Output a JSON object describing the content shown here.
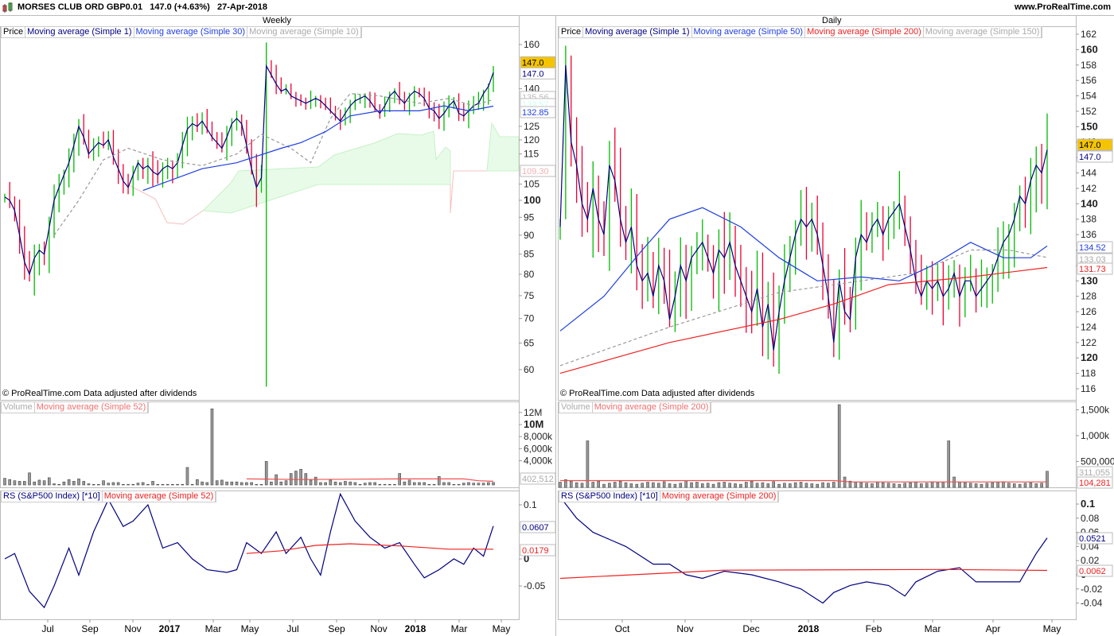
{
  "header": {
    "title": "MORSES CLUB ORD GBP0.01",
    "price": "147.0",
    "change": "(+4.63%)",
    "date": "27-Apr-2018",
    "site": "www.ProRealTime.com"
  },
  "left": {
    "period": "Weekly",
    "price_legend": [
      "Price",
      "Moving average (Simple 1)",
      "Moving average (Simple 30)",
      "Moving average (Simple 10)"
    ],
    "vol_legend": [
      "Volume",
      "Moving average (Simple 52)"
    ],
    "rs_legend": [
      "RS (S&P500 Index) [*10]",
      "Moving average (Simple 52)"
    ],
    "copyright": "© ProRealTime.com  Data adjusted after dividends",
    "price_ticks": [
      "160",
      "140",
      "125",
      "120",
      "115",
      "105",
      "100",
      "95",
      "90",
      "85",
      "80",
      "75",
      "70",
      "65",
      "60"
    ],
    "price_tags": {
      "last": "147.0",
      "ma1": "147.0",
      "ma10": "135.56",
      "cloud": "133.57",
      "ma30": "132.85",
      "cloud_low": "109.30"
    },
    "vol_ticks": [
      "12M",
      "10M",
      "8,000k",
      "6,000k",
      "4,000k"
    ],
    "vol_tag": "402,512",
    "rs_ticks": [
      "0.1",
      "0",
      "-0.05"
    ],
    "rs_tags": {
      "rs": "0.0607",
      "ma": "0.0179"
    },
    "x_labels": [
      "Jul",
      "Sep",
      "Nov",
      "2017",
      "Mar",
      "May",
      "Jul",
      "Sep",
      "Nov",
      "2018",
      "Mar",
      "May"
    ]
  },
  "right": {
    "period": "Daily",
    "price_legend": [
      "Price",
      "Moving average (Simple 1)",
      "Moving average (Simple 50)",
      "Moving average (Simple 200)",
      "Moving average (Simple 150)"
    ],
    "vol_legend": [
      "Volume",
      "Moving average (Simple 200)"
    ],
    "rs_legend": [
      "RS (S&P500 Index) [*10]",
      "Moving average (Simple 200)"
    ],
    "copyright": "© ProRealTime.com  Data adjusted after dividends",
    "price_ticks": [
      "162",
      "160",
      "158",
      "156",
      "154",
      "152",
      "150",
      "148",
      "146",
      "144",
      "142",
      "140",
      "138",
      "136",
      "134",
      "132",
      "130",
      "128",
      "126",
      "124",
      "122",
      "120",
      "118",
      "116"
    ],
    "price_tags": {
      "last": "147.0",
      "ma1": "147.0",
      "ma50": "134.52",
      "ma150": "133.03",
      "ma200": "131.73"
    },
    "vol_ticks": [
      "1,500k",
      "1,000k",
      "500,000"
    ],
    "vol_tags": {
      "vol": "311,055",
      "ma": "104,281"
    },
    "rs_ticks": [
      "0.1",
      "0.08",
      "0.06",
      "0.04",
      "0.02",
      "0",
      "-0.02",
      "-0.04"
    ],
    "rs_tags": {
      "rs": "0.0521",
      "ma": "0.0062"
    },
    "x_labels": [
      "Oct",
      "Nov",
      "Dec",
      "2018",
      "Feb",
      "Mar",
      "Apr",
      "May"
    ]
  },
  "colors": {
    "up": "#00bb00",
    "down": "#ee0033",
    "ma1": "#000080",
    "ma_blue": "#1f3fe0",
    "ma_red": "#ee2222",
    "ma_grey": "#999999",
    "highlight": "#f5c400"
  },
  "chart_data": [
    {
      "type": "bar",
      "title": "Weekly",
      "scale": "log",
      "ylim": [
        56,
        165
      ],
      "close": [
        101,
        100,
        97,
        90,
        83,
        80,
        84,
        86,
        85,
        92,
        100,
        104,
        108,
        112,
        118,
        125,
        121,
        115,
        117,
        119,
        118,
        120,
        114,
        110,
        106,
        104,
        108,
        112,
        110,
        111,
        109,
        108,
        110,
        111,
        110,
        112,
        118,
        124,
        126,
        125,
        127,
        124,
        121,
        119,
        117,
        121,
        126,
        128,
        126,
        118,
        110,
        104,
        107,
        150,
        146,
        142,
        139,
        140,
        137,
        136,
        135,
        134,
        135,
        136,
        135,
        133,
        131,
        129,
        127,
        130,
        133,
        135,
        136,
        137,
        135,
        132,
        130,
        133,
        137,
        139,
        136,
        134,
        137,
        139,
        138,
        136,
        132,
        131,
        128,
        130,
        133,
        135,
        130,
        129,
        131,
        133,
        134,
        138,
        141,
        147
      ],
      "spikes": [
        {
          "index": 53,
          "low": 57,
          "high": 161
        },
        {
          "index": 51,
          "low": 98,
          "high": 115
        }
      ],
      "ma30": [
        [
          28,
          103
        ],
        [
          40,
          110
        ],
        [
          47,
          112
        ],
        [
          56,
          117
        ],
        [
          60,
          119
        ],
        [
          65,
          123
        ],
        [
          70,
          129
        ],
        [
          76,
          131
        ],
        [
          84,
          131
        ],
        [
          89,
          133
        ],
        [
          94,
          131
        ],
        [
          99,
          132.85
        ]
      ],
      "ma10": [
        [
          10,
          90
        ],
        [
          15,
          100
        ],
        [
          20,
          113
        ],
        [
          25,
          117
        ],
        [
          32,
          113
        ],
        [
          40,
          111
        ],
        [
          47,
          115
        ],
        [
          52,
          122
        ],
        [
          58,
          117
        ],
        [
          62,
          112
        ],
        [
          66,
          128
        ],
        [
          70,
          138
        ],
        [
          76,
          137
        ],
        [
          84,
          134
        ],
        [
          90,
          136
        ],
        [
          95,
          133
        ],
        [
          99,
          135.56
        ]
      ],
      "volume_k": [
        1100,
        900,
        700,
        600,
        600,
        2000,
        500,
        800,
        700,
        1200,
        200,
        100,
        500,
        900,
        600,
        1000,
        600,
        200,
        100,
        100,
        700,
        300,
        400,
        400,
        100,
        100,
        100,
        300,
        400,
        100,
        600,
        100,
        100,
        100,
        100,
        100,
        100,
        2900,
        100,
        900,
        500,
        400,
        12600,
        700,
        800,
        500,
        500,
        500,
        400,
        400,
        400,
        100,
        100,
        3900,
        500,
        1700,
        500,
        700,
        1900,
        2300,
        2600,
        1900,
        800,
        1300,
        400,
        400,
        800,
        500,
        400,
        600,
        500,
        400,
        100,
        300,
        400,
        400,
        100,
        100,
        100,
        100,
        1900,
        500,
        800,
        400,
        400,
        400,
        100,
        100,
        1400,
        400,
        400,
        100,
        100,
        300,
        400,
        300,
        300,
        300,
        400,
        402
      ],
      "vol_ma_k": [
        [
          49,
          1000
        ],
        [
          60,
          900
        ],
        [
          70,
          950
        ],
        [
          80,
          1000
        ],
        [
          93,
          1000
        ],
        [
          96,
          700
        ],
        [
          99,
          600
        ]
      ],
      "rs": [
        [
          0,
          0.0
        ],
        [
          2,
          0.01
        ],
        [
          5,
          -0.06
        ],
        [
          8,
          -0.09
        ],
        [
          10,
          -0.05
        ],
        [
          13,
          0.02
        ],
        [
          15,
          -0.03
        ],
        [
          18,
          0.05
        ],
        [
          21,
          0.11
        ],
        [
          24,
          0.06
        ],
        [
          26,
          0.07
        ],
        [
          29,
          0.1
        ],
        [
          32,
          0.02
        ],
        [
          35,
          0.03
        ],
        [
          38,
          0.0
        ],
        [
          41,
          -0.02
        ],
        [
          45,
          -0.025
        ],
        [
          47,
          -0.02
        ],
        [
          49,
          0.03
        ],
        [
          52,
          0.01
        ],
        [
          55,
          0.05
        ],
        [
          57,
          0.01
        ],
        [
          60,
          0.04
        ],
        [
          62,
          0.0
        ],
        [
          64,
          -0.03
        ],
        [
          66,
          0.05
        ],
        [
          68,
          0.12
        ],
        [
          71,
          0.07
        ],
        [
          74,
          0.04
        ],
        [
          77,
          0.02
        ],
        [
          80,
          0.03
        ],
        [
          83,
          -0.01
        ],
        [
          85,
          -0.035
        ],
        [
          88,
          -0.02
        ],
        [
          91,
          0.0
        ],
        [
          93,
          -0.01
        ],
        [
          95,
          0.02
        ],
        [
          97,
          0.005
        ],
        [
          99,
          0.0607
        ]
      ],
      "rs_ma": [
        [
          49,
          0.01
        ],
        [
          56,
          0.015
        ],
        [
          63,
          0.025
        ],
        [
          70,
          0.028
        ],
        [
          80,
          0.024
        ],
        [
          90,
          0.018
        ],
        [
          99,
          0.0179
        ]
      ]
    },
    {
      "type": "bar",
      "title": "Daily",
      "scale": "linear",
      "ylim": [
        115,
        163
      ],
      "close": [
        137,
        158,
        148,
        145,
        140,
        138,
        142,
        138,
        136,
        145,
        143,
        138,
        135,
        137,
        132,
        130,
        131,
        128,
        132,
        130,
        125,
        128,
        132,
        130,
        133,
        134,
        135,
        133,
        131,
        134,
        133,
        135,
        132,
        130,
        128,
        126,
        129,
        124,
        127,
        121,
        126,
        130,
        133,
        136,
        138,
        137,
        138,
        136,
        132,
        128,
        122,
        130,
        126,
        125,
        133,
        136,
        135,
        137,
        138,
        136,
        138,
        139,
        140,
        137,
        134,
        130,
        128,
        130,
        129,
        130,
        128,
        129,
        131,
        128,
        130,
        130,
        128,
        129,
        130,
        131,
        133,
        135,
        136,
        138,
        141,
        140,
        143,
        145,
        144,
        147
      ],
      "ma50": [
        [
          0,
          123.5
        ],
        [
          8,
          128
        ],
        [
          15,
          134
        ],
        [
          20,
          138
        ],
        [
          26,
          139.5
        ],
        [
          33,
          137
        ],
        [
          40,
          133
        ],
        [
          47,
          130
        ],
        [
          55,
          130.5
        ],
        [
          62,
          130
        ],
        [
          68,
          132
        ],
        [
          75,
          135
        ],
        [
          81,
          133
        ],
        [
          86,
          133
        ],
        [
          89,
          134.52
        ]
      ],
      "ma200": [
        [
          0,
          118
        ],
        [
          20,
          122
        ],
        [
          40,
          125
        ],
        [
          50,
          127
        ],
        [
          60,
          129.5
        ],
        [
          75,
          130.5
        ],
        [
          89,
          131.73
        ]
      ],
      "ma150": [
        [
          0,
          119
        ],
        [
          20,
          124
        ],
        [
          40,
          128.5
        ],
        [
          55,
          130
        ],
        [
          65,
          131
        ],
        [
          75,
          134
        ],
        [
          82,
          134
        ],
        [
          89,
          133.03
        ]
      ],
      "volume_k": [
        100,
        150,
        120,
        90,
        80,
        900,
        100,
        120,
        60,
        80,
        100,
        120,
        90,
        70,
        60,
        80,
        100,
        90,
        80,
        110,
        70,
        60,
        80,
        130,
        90,
        100,
        70,
        80,
        60,
        90,
        100,
        80,
        70,
        60,
        100,
        120,
        80,
        90,
        70,
        110,
        60,
        80,
        70,
        90,
        100,
        80,
        70,
        60,
        90,
        80,
        100,
        1600,
        200,
        120,
        100,
        90,
        80,
        70,
        100,
        90,
        80,
        70,
        60,
        80,
        90,
        100,
        70,
        80,
        110,
        90,
        100,
        900,
        200,
        100,
        90,
        80,
        70,
        60,
        80,
        90,
        100,
        110,
        80,
        70,
        60,
        80,
        90,
        70,
        80,
        311
      ],
      "vol_ma_k": [
        [
          0,
          130
        ],
        [
          50,
          130
        ],
        [
          53,
          105
        ],
        [
          89,
          104
        ]
      ],
      "rs": [
        [
          0,
          0.11
        ],
        [
          3,
          0.08
        ],
        [
          6,
          0.06
        ],
        [
          9,
          0.05
        ],
        [
          12,
          0.04
        ],
        [
          14,
          0.03
        ],
        [
          17,
          0.015
        ],
        [
          20,
          0.015
        ],
        [
          23,
          0.0
        ],
        [
          26,
          -0.005
        ],
        [
          30,
          0.005
        ],
        [
          35,
          0.0
        ],
        [
          40,
          -0.01
        ],
        [
          44,
          -0.02
        ],
        [
          46,
          -0.03
        ],
        [
          48,
          -0.04
        ],
        [
          50,
          -0.025
        ],
        [
          53,
          -0.015
        ],
        [
          56,
          -0.01
        ],
        [
          60,
          -0.015
        ],
        [
          63,
          -0.03
        ],
        [
          65,
          -0.01
        ],
        [
          69,
          0.005
        ],
        [
          73,
          0.01
        ],
        [
          76,
          -0.01
        ],
        [
          80,
          -0.01
        ],
        [
          84,
          -0.01
        ],
        [
          87,
          0.03
        ],
        [
          89,
          0.0521
        ]
      ],
      "rs_ma": [
        [
          0,
          -0.005
        ],
        [
          30,
          0.0065
        ],
        [
          70,
          0.0075
        ],
        [
          89,
          0.0062
        ]
      ]
    }
  ]
}
